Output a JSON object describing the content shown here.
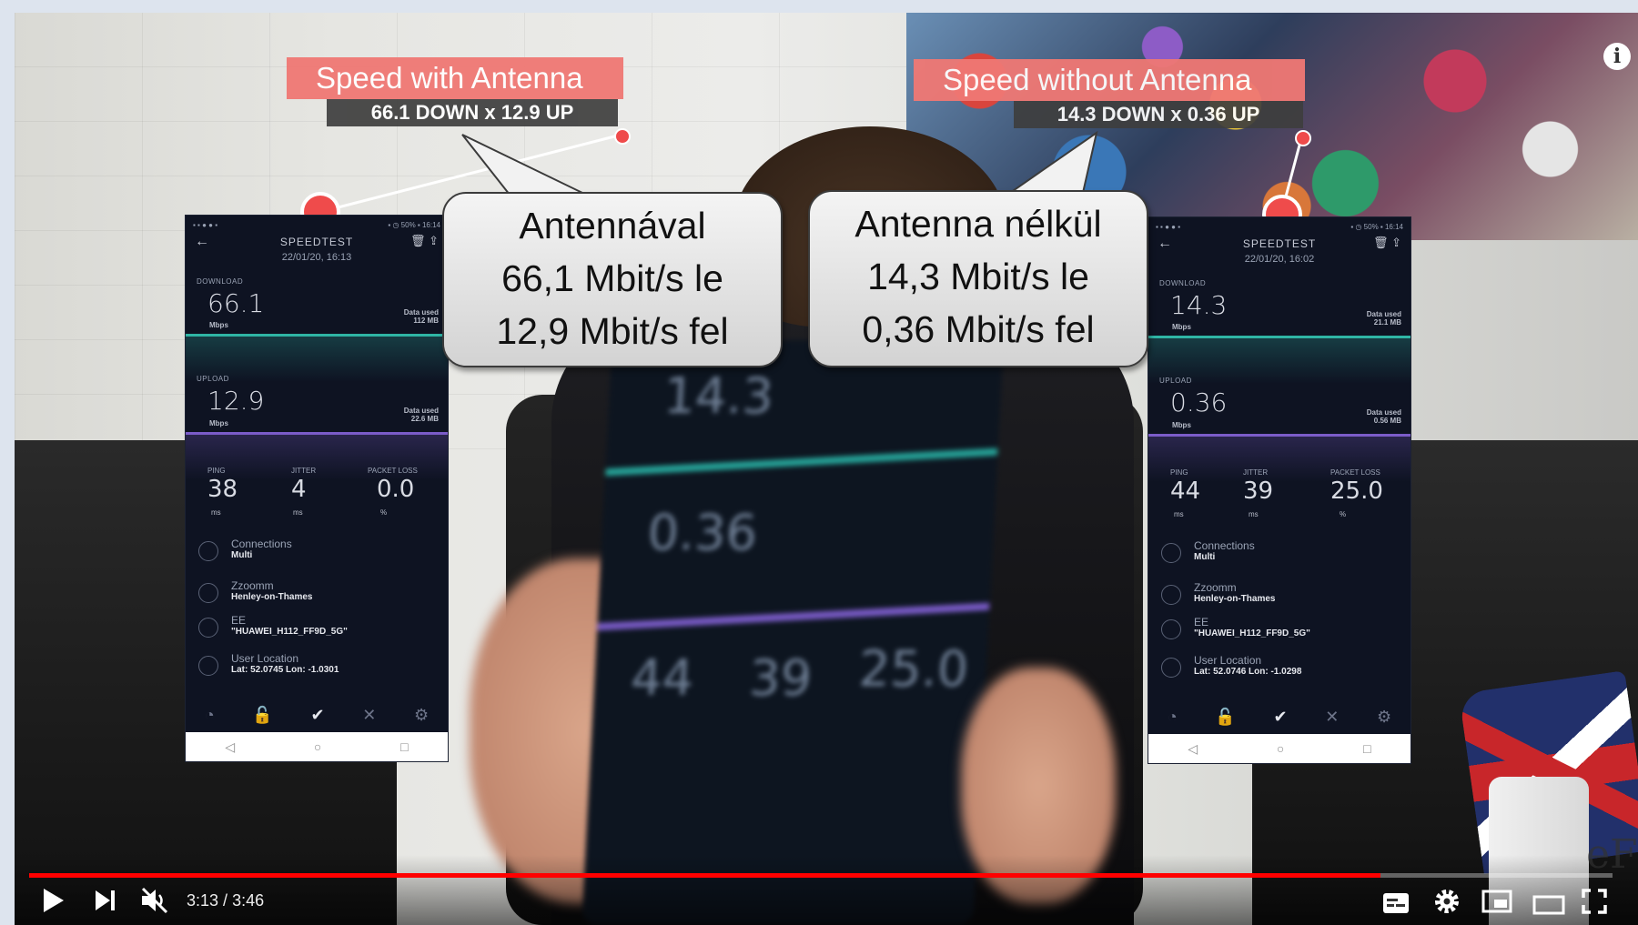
{
  "overlays": {
    "left": {
      "title": "Speed with Antenna",
      "subtitle": "66.1 DOWN  x 12.9 UP"
    },
    "right": {
      "title": "Speed without Antenna",
      "subtitle": "14.3 DOWN  x 0.36 UP"
    }
  },
  "bubbles": {
    "left": {
      "line1": "Antennával",
      "line2": "66,1 Mbit/s le",
      "line3": "12,9 Mbit/s fel"
    },
    "right": {
      "line1": "Antenna nélkül",
      "line2": "14,3 Mbit/s le",
      "line3": "0,36 Mbit/s fel"
    }
  },
  "phones": {
    "left": {
      "app": "SPEEDTEST",
      "date": "22/01/20, 16:13",
      "download_label": "DOWNLOAD",
      "download": "66.1",
      "download_unit": "Mbps",
      "download_used_label": "Data used",
      "download_used": "112 MB",
      "upload_label": "UPLOAD",
      "upload": "12.9",
      "upload_unit": "Mbps",
      "upload_used_label": "Data used",
      "upload_used": "22.6 MB",
      "ping_label": "PING",
      "ping": "38",
      "ping_unit": "ms",
      "jitter_label": "JITTER",
      "jitter": "4",
      "jitter_unit": "ms",
      "loss_label": "PACKET LOSS",
      "loss": "0.0",
      "loss_unit": "%",
      "connections_label": "Connections",
      "connections": "Multi",
      "server_label": "Zzoomm",
      "server": "Henley-on-Thames",
      "network_label": "EE",
      "network": "\"HUAWEI_H112_FF9D_5G\"",
      "location_label": "User Location",
      "location": "Lat: 52.0745 Lon: -1.0301"
    },
    "right": {
      "app": "SPEEDTEST",
      "date": "22/01/20, 16:02",
      "download_label": "DOWNLOAD",
      "download": "14.3",
      "download_unit": "Mbps",
      "download_used_label": "Data used",
      "download_used": "21.1 MB",
      "upload_label": "UPLOAD",
      "upload": "0.36",
      "upload_unit": "Mbps",
      "upload_used_label": "Data used",
      "upload_used": "0.56 MB",
      "ping_label": "PING",
      "ping": "44",
      "ping_unit": "ms",
      "jitter_label": "JITTER",
      "jitter": "39",
      "jitter_unit": "ms",
      "loss_label": "PACKET LOSS",
      "loss": "25.0",
      "loss_unit": "%",
      "connections_label": "Connections",
      "connections": "Multi",
      "server_label": "Zzoomm",
      "server": "Henley-on-Thames",
      "network_label": "EE",
      "network": "\"HUAWEI_H112_FF9D_5G\"",
      "location_label": "User Location",
      "location": "Lat: 52.0746 Lon: -1.0298"
    }
  },
  "blurred_phone": {
    "download": "14.3",
    "upload": "0.36",
    "ping": "44",
    "jitter": "39",
    "loss": "25.0"
  },
  "watermark": "eF",
  "player": {
    "current_time": "3:13",
    "separator": " / ",
    "duration": "3:46",
    "progress_fraction": 0.8534,
    "icons": [
      "play-icon",
      "next-icon",
      "mute-icon",
      "subtitles-icon",
      "settings-icon",
      "miniplayer-icon",
      "theater-icon",
      "fullscreen-icon",
      "info-icon"
    ]
  }
}
